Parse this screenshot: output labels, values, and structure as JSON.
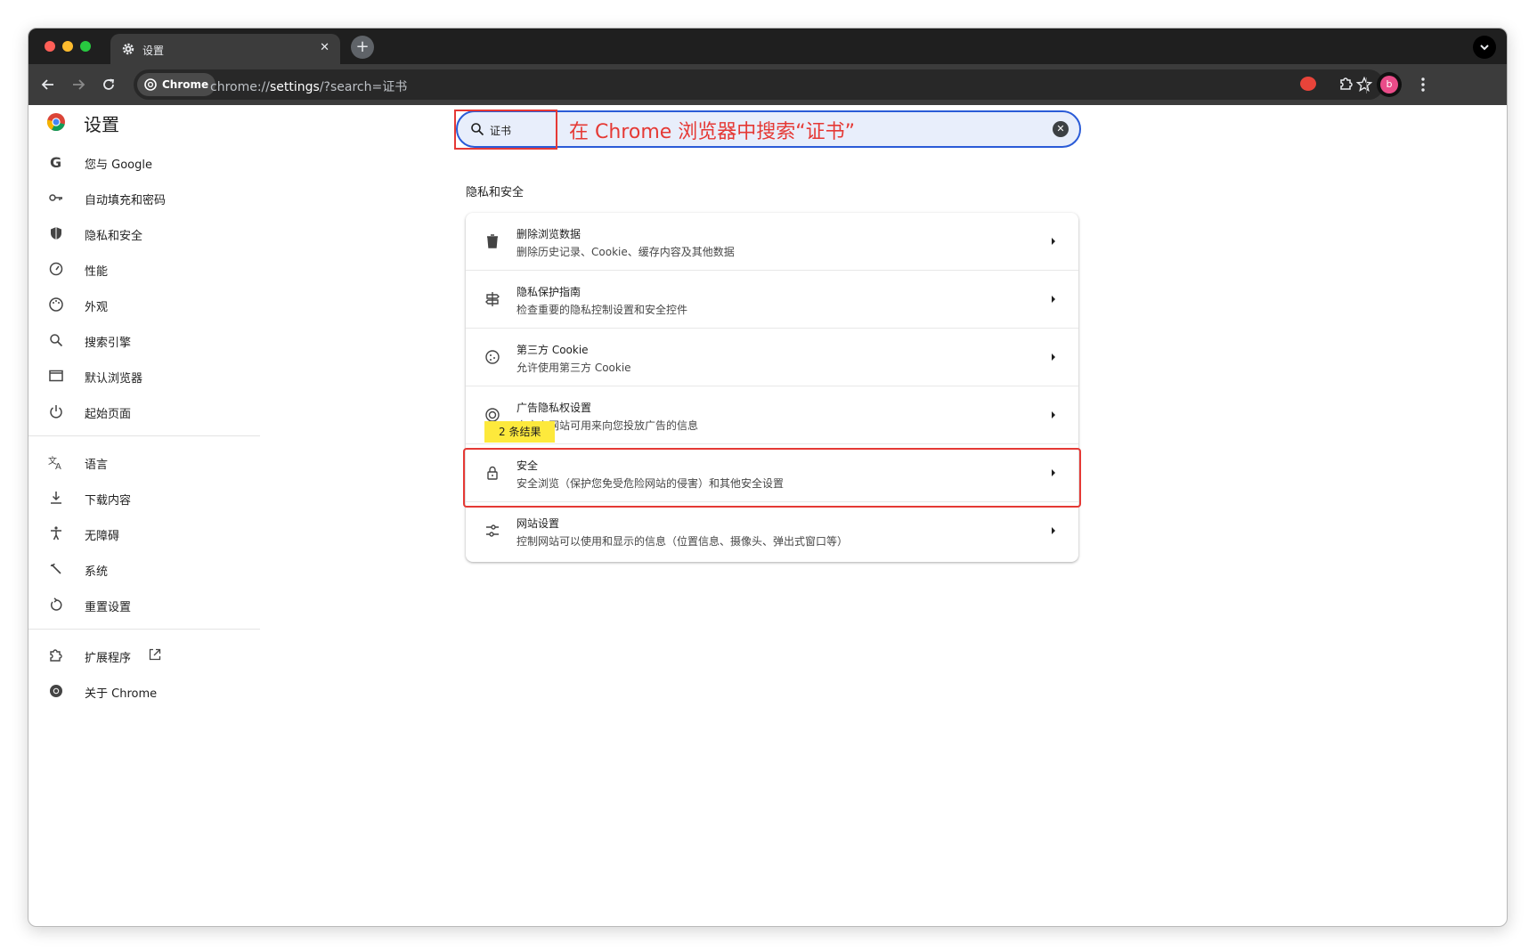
{
  "tab": {
    "title": "设置",
    "icon": "gear-icon"
  },
  "toolbar": {
    "chip_label": "Chrome",
    "url_prefix": "chrome://",
    "url_bold": "settings",
    "url_suffix": "/?search=证书"
  },
  "sidebar": {
    "title": "设置",
    "items": [
      {
        "label": "您与 Google",
        "icon": "google-icon"
      },
      {
        "label": "自动填充和密码",
        "icon": "key-icon"
      },
      {
        "label": "隐私和安全",
        "icon": "shield-icon"
      },
      {
        "label": "性能",
        "icon": "speedometer-icon"
      },
      {
        "label": "外观",
        "icon": "palette-icon"
      },
      {
        "label": "搜索引擎",
        "icon": "search-icon"
      },
      {
        "label": "默认浏览器",
        "icon": "browser-window-icon"
      },
      {
        "label": "起始页面",
        "icon": "power-icon"
      },
      {
        "label": "语言",
        "icon": "translate-icon"
      },
      {
        "label": "下载内容",
        "icon": "download-icon"
      },
      {
        "label": "无障碍",
        "icon": "accessibility-icon"
      },
      {
        "label": "系统",
        "icon": "wrench-icon"
      },
      {
        "label": "重置设置",
        "icon": "reset-icon"
      },
      {
        "label": "扩展程序",
        "icon": "puzzle-icon"
      },
      {
        "label": "关于 Chrome",
        "icon": "chrome-icon"
      }
    ]
  },
  "search": {
    "value": "证书"
  },
  "annotation": "在 Chrome 浏览器中搜索“证书”",
  "section": {
    "title": "隐私和安全",
    "rows": [
      {
        "title": "删除浏览数据",
        "subtitle": "删除历史记录、Cookie、缓存内容及其他数据",
        "icon": "trash-icon"
      },
      {
        "title": "隐私保护指南",
        "subtitle": "检查重要的隐私控制设置和安全控件",
        "icon": "signpost-icon"
      },
      {
        "title": "第三方 Cookie",
        "subtitle": "允许使用第三方 Cookie",
        "icon": "cookie-icon"
      },
      {
        "title": "广告隐私权设置",
        "subtitle": "自定义网站可用来向您投放广告的信息",
        "icon": "ad-privacy-icon"
      },
      {
        "title": "安全",
        "subtitle": "安全浏览（保护您免受危险网站的侵害）和其他安全设置",
        "icon": "lock-icon"
      },
      {
        "title": "网站设置",
        "subtitle": "控制网站可以使用和显示的信息（位置信息、摄像头、弹出式窗口等）",
        "icon": "sliders-icon"
      }
    ]
  },
  "badge": "2 条结果",
  "avatar_letter": "b",
  "colors": {
    "accent": "#2a5bd7",
    "highlight": "#e53935",
    "badge": "#fde93c"
  }
}
